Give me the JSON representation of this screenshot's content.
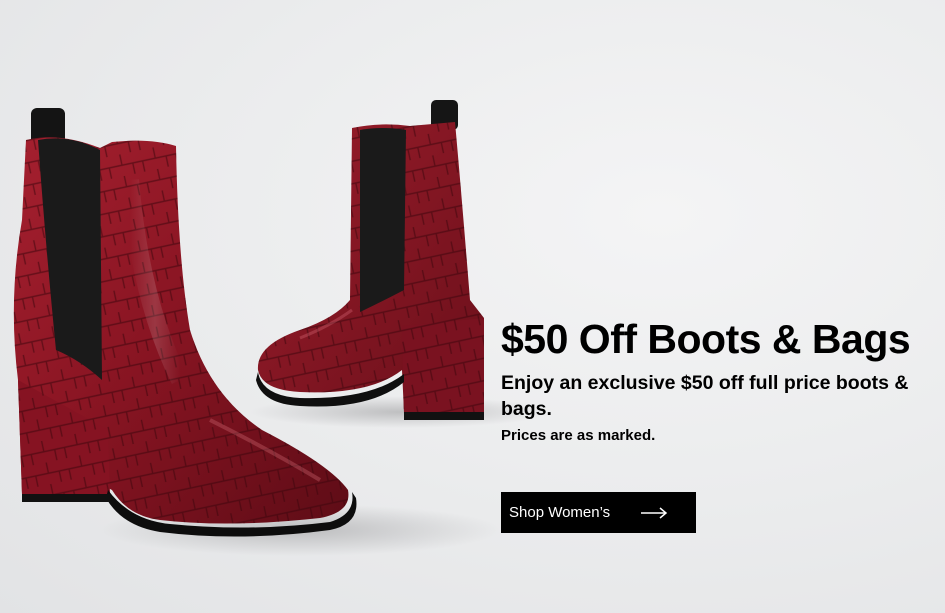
{
  "hero": {
    "title": "$50 Off Boots & Bags",
    "subtitle": "Enjoy an exclusive $50 off full price boots & bags.",
    "note": "Prices are as marked.",
    "cta_label": "Shop Women’s",
    "image_subject": "red-croc-chelsea-boots",
    "colors": {
      "background": "#ececed",
      "boot_leather": "#8e1a26",
      "cta_background": "#000000",
      "cta_text": "#ffffff",
      "text": "#000000"
    }
  }
}
